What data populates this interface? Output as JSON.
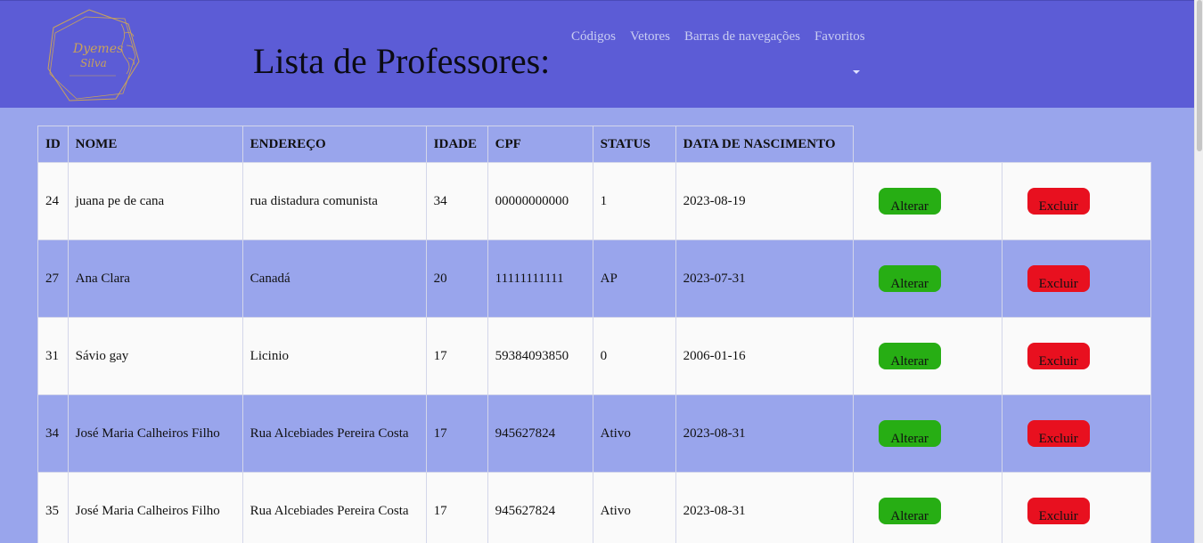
{
  "header": {
    "title": "Lista de Professores:",
    "logo_text": "Dyemes Silva",
    "nav": [
      "Códigos",
      "Vetores",
      "Barras de navegações",
      "Favoritos"
    ]
  },
  "table": {
    "columns": [
      "ID",
      "NOME",
      "ENDEREÇO",
      "IDADE",
      "CPF",
      "STATUS",
      "DATA DE NASCIMENTO"
    ],
    "rows": [
      {
        "id": "24",
        "nome": "juana pe de cana",
        "endereco": "rua distadura comunista",
        "idade": "34",
        "cpf": "00000000000",
        "status": "1",
        "nascimento": "2023-08-19"
      },
      {
        "id": "27",
        "nome": "Ana Clara",
        "endereco": "Canadá",
        "idade": "20",
        "cpf": "11111111111",
        "status": "AP",
        "nascimento": "2023-07-31"
      },
      {
        "id": "31",
        "nome": "Sávio gay",
        "endereco": "Licinio",
        "idade": "17",
        "cpf": "59384093850",
        "status": "0",
        "nascimento": "2006-01-16"
      },
      {
        "id": "34",
        "nome": "José Maria Calheiros Filho",
        "endereco": "Rua Alcebiades Pereira Costa",
        "idade": "17",
        "cpf": "945627824",
        "status": "Ativo",
        "nascimento": "2023-08-31"
      },
      {
        "id": "35",
        "nome": "José Maria Calheiros Filho",
        "endereco": "Rua Alcebiades Pereira Costa",
        "idade": "17",
        "cpf": "945627824",
        "status": "Ativo",
        "nascimento": "2023-08-31"
      }
    ],
    "alter_label": "Alterar",
    "delete_label": "Excluir"
  },
  "colors": {
    "header_bg": "#5c5cd6",
    "page_bg": "#99a5ec",
    "alter_button": "#27ae14",
    "delete_button": "#e8101f"
  }
}
